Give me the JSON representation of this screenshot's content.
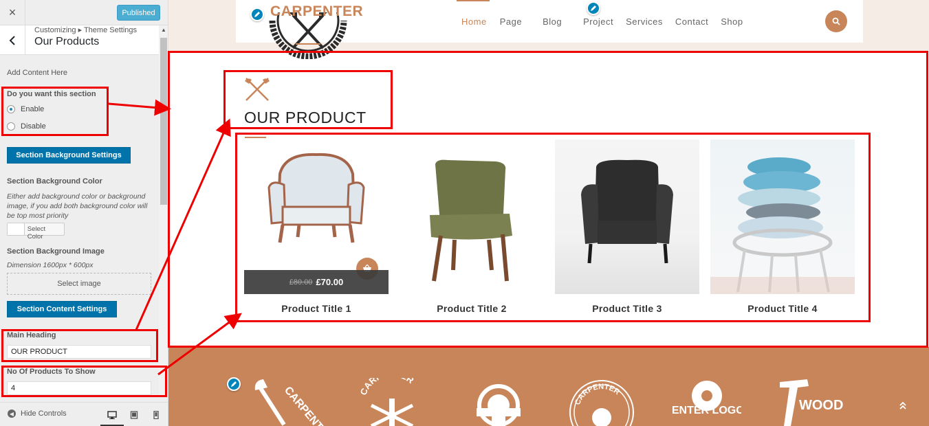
{
  "customizer": {
    "close_label": "×",
    "published_label": "Published",
    "breadcrumb": "Customizing ▸ Theme Settings",
    "section_title": "Our Products",
    "add_content_label": "Add Content Here",
    "section_toggle": {
      "label": "Do you want this section",
      "options": [
        "Enable",
        "Disable"
      ],
      "selected": "Enable"
    },
    "bg_settings_button": "Section Background Settings",
    "bg_color": {
      "label": "Section Background Color",
      "note": "Either add background color or background image, if you add both background color will be top most priority",
      "button": "Select Color"
    },
    "bg_image": {
      "label": "Section Background Image",
      "note": "Dimension 1600px * 600px",
      "button": "Select image"
    },
    "content_settings_button": "Section Content Settings",
    "main_heading": {
      "label": "Main Heading",
      "value": "OUR PRODUCT"
    },
    "products_count": {
      "label": "No Of Products To Show",
      "value": "4"
    },
    "hide_controls_label": "Hide Controls",
    "devices": [
      "desktop-icon",
      "tablet-icon",
      "mobile-icon"
    ]
  },
  "site": {
    "logo_text": "CARPENTER",
    "nav": [
      "Home",
      "Page",
      "Blog",
      "Project",
      "Services",
      "Contact",
      "Shop"
    ],
    "active_nav": "Home",
    "section_heading": "OUR PRODUCT",
    "products": [
      {
        "title": "Product Title 1",
        "old_price": "£80.00",
        "price": "£70.00"
      },
      {
        "title": "Product Title 2"
      },
      {
        "title": "Product Title 3"
      },
      {
        "title": "Product Title 4"
      }
    ],
    "footer_logos": [
      "CARPENTER",
      "CARPENTER",
      "",
      "CARPENTER",
      "CARPENTER LOGOTYPE",
      "WOOD WORK"
    ]
  },
  "colors": {
    "accent": "#c8855a",
    "annotation": "#ee0000",
    "wp_blue": "#0073aa"
  }
}
